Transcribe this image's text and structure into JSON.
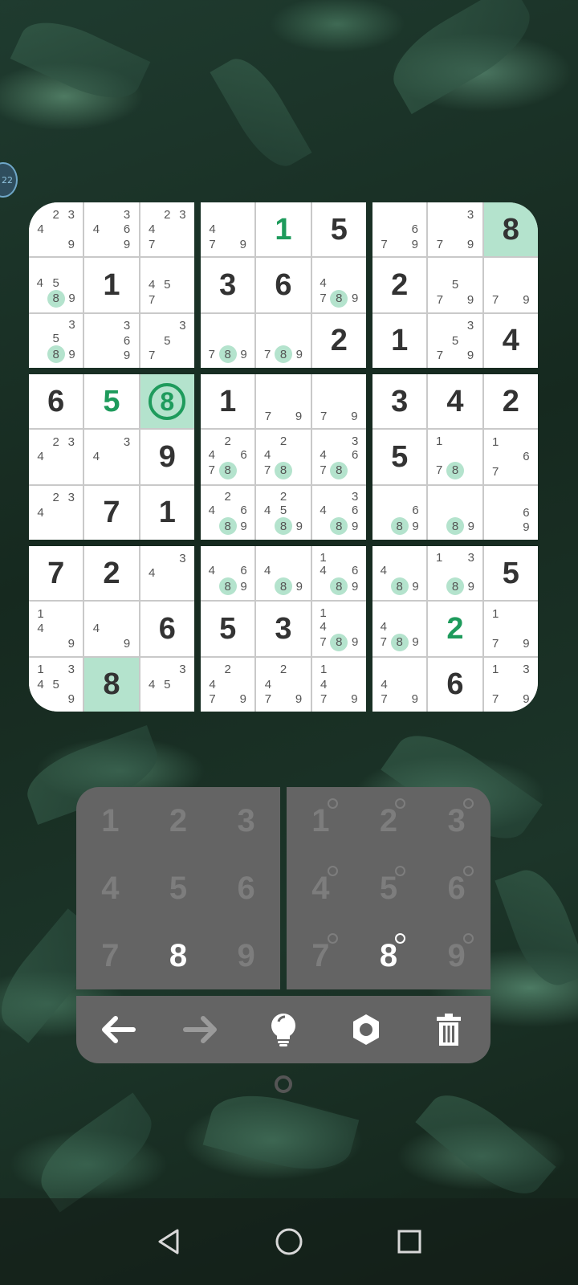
{
  "edge_badge": "22",
  "board": [
    [
      {
        "n": [
          "2",
          "3",
          "4",
          "",
          "",
          "9"
        ],
        "v": "",
        "hl": false,
        "h": []
      },
      {
        "v": "",
        "n": [
          "3",
          "4",
          "6",
          "9"
        ],
        "h": []
      },
      {
        "v": "",
        "n": [
          "2",
          "3",
          "4",
          "7"
        ],
        "h": []
      },
      {
        "v": "",
        "n": [
          "4",
          "5",
          "8",
          "9"
        ],
        "h": [
          "8"
        ]
      },
      {
        "v": "1"
      },
      {
        "v": "",
        "n": [
          "4",
          "5",
          "7"
        ],
        "h": []
      },
      {
        "v": "",
        "n": [
          "3",
          "5",
          "8",
          "9"
        ],
        "h": [
          "8"
        ]
      },
      {
        "v": "",
        "n": [
          "3",
          "6",
          "9"
        ],
        "h": []
      },
      {
        "v": "",
        "n": [
          "3",
          "5",
          "7"
        ],
        "h": []
      }
    ],
    [
      {
        "v": "",
        "n": [
          "4",
          "7",
          "9"
        ],
        "h": []
      },
      {
        "v": "1",
        "g": true
      },
      {
        "v": "5"
      },
      {
        "v": "3"
      },
      {
        "v": "6"
      },
      {
        "v": "",
        "n": [
          "4",
          "7",
          "8",
          "9"
        ],
        "h": [
          "8"
        ]
      },
      {
        "v": "",
        "n": [
          "7",
          "8",
          "9"
        ],
        "h": [
          "8"
        ]
      },
      {
        "v": "",
        "n": [
          "7",
          "8",
          "9"
        ],
        "h": [
          "8"
        ]
      },
      {
        "v": "2"
      }
    ],
    [
      {
        "v": "",
        "n": [
          "6",
          "7",
          "9"
        ],
        "h": []
      },
      {
        "v": "",
        "n": [
          "3",
          "7",
          "9"
        ],
        "h": []
      },
      {
        "v": "8",
        "hl": true
      },
      {
        "v": "2"
      },
      {
        "v": "",
        "n": [
          "5",
          "7",
          "9"
        ],
        "h": []
      },
      {
        "v": "",
        "n": [
          "7",
          "9"
        ],
        "h": []
      },
      {
        "v": "1"
      },
      {
        "v": "",
        "n": [
          "3",
          "5",
          "7",
          "9"
        ],
        "h": []
      },
      {
        "v": "4"
      }
    ],
    [
      {
        "v": "6"
      },
      {
        "v": "5",
        "g": true
      },
      {
        "v": "8",
        "ring": true,
        "hl": true
      },
      {
        "v": "",
        "n": [
          "2",
          "3",
          "4"
        ],
        "h": []
      },
      {
        "v": "",
        "n": [
          "3",
          "4"
        ],
        "h": []
      },
      {
        "v": "9"
      },
      {
        "v": "",
        "n": [
          "2",
          "3",
          "4"
        ],
        "h": []
      },
      {
        "v": "7"
      },
      {
        "v": "1"
      }
    ],
    [
      {
        "v": "1"
      },
      {
        "v": "",
        "n": [
          "7",
          "9"
        ],
        "h": []
      },
      {
        "v": "",
        "n": [
          "7",
          "9"
        ],
        "h": []
      },
      {
        "v": "",
        "n": [
          "2",
          "4",
          "6",
          "7",
          "8"
        ],
        "h": [
          "8"
        ]
      },
      {
        "v": "",
        "n": [
          "2",
          "4",
          "7",
          "8"
        ],
        "h": [
          "8"
        ]
      },
      {
        "v": "",
        "n": [
          "3",
          "4",
          "6",
          "7",
          "8"
        ],
        "h": [
          "8"
        ]
      },
      {
        "v": "",
        "n": [
          "2",
          "4",
          "6",
          "8",
          "9"
        ],
        "h": [
          "8"
        ]
      },
      {
        "v": "",
        "n": [
          "2",
          "4",
          "5",
          "8",
          "9"
        ],
        "h": [
          "8"
        ]
      },
      {
        "v": "",
        "n": [
          "3",
          "4",
          "6",
          "8",
          "9"
        ],
        "h": [
          "8"
        ]
      }
    ],
    [
      {
        "v": "3"
      },
      {
        "v": "4"
      },
      {
        "v": "2"
      },
      {
        "v": "5"
      },
      {
        "v": "",
        "n": [
          "1",
          "7",
          "8"
        ],
        "h": [
          "8"
        ]
      },
      {
        "v": "",
        "n": [
          "1",
          "6",
          "7"
        ],
        "h": []
      },
      {
        "v": "",
        "n": [
          "6",
          "8",
          "9"
        ],
        "h": [
          "8"
        ]
      },
      {
        "v": "",
        "n": [
          "8",
          "9"
        ],
        "h": [
          "8"
        ]
      },
      {
        "v": "",
        "n": [
          "6",
          "9"
        ],
        "h": []
      }
    ],
    [
      {
        "v": "7"
      },
      {
        "v": "2"
      },
      {
        "v": "",
        "n": [
          "3",
          "4"
        ],
        "h": []
      },
      {
        "v": "",
        "n": [
          "1",
          "4",
          "9"
        ],
        "h": []
      },
      {
        "v": "",
        "n": [
          "4",
          "9"
        ],
        "h": []
      },
      {
        "v": "6"
      },
      {
        "v": "",
        "n": [
          "1",
          "3",
          "4",
          "5",
          "9"
        ],
        "h": []
      },
      {
        "v": "8",
        "hl": true
      },
      {
        "v": "",
        "n": [
          "3",
          "4",
          "5"
        ],
        "h": []
      }
    ],
    [
      {
        "v": "",
        "n": [
          "4",
          "6",
          "8",
          "9"
        ],
        "h": [
          "8"
        ]
      },
      {
        "v": "",
        "n": [
          "4",
          "8",
          "9"
        ],
        "h": [
          "8"
        ]
      },
      {
        "v": "",
        "n": [
          "1",
          "4",
          "6",
          "8",
          "9"
        ],
        "h": [
          "8"
        ]
      },
      {
        "v": "5"
      },
      {
        "v": "3"
      },
      {
        "v": "",
        "n": [
          "1",
          "4",
          "7",
          "8",
          "9"
        ],
        "h": [
          "8"
        ]
      },
      {
        "v": "",
        "n": [
          "2",
          "4",
          "7",
          "9"
        ],
        "h": []
      },
      {
        "v": "",
        "n": [
          "2",
          "4",
          "7",
          "9"
        ],
        "h": []
      },
      {
        "v": "",
        "n": [
          "1",
          "4",
          "7",
          "9"
        ],
        "h": []
      }
    ],
    [
      {
        "v": "",
        "n": [
          "4",
          "8",
          "9"
        ],
        "h": [
          "8"
        ]
      },
      {
        "v": "",
        "n": [
          "1",
          "3",
          "8",
          "9"
        ],
        "h": [
          "8"
        ]
      },
      {
        "v": "5"
      },
      {
        "v": "",
        "n": [
          "4",
          "7",
          "8",
          "9"
        ],
        "h": [
          "8"
        ]
      },
      {
        "v": "2",
        "g": true
      },
      {
        "v": "",
        "n": [
          "1",
          "7",
          "9"
        ],
        "h": []
      },
      {
        "v": "",
        "n": [
          "4",
          "7",
          "9"
        ],
        "h": []
      },
      {
        "v": "6"
      },
      {
        "v": "",
        "n": [
          "1",
          "3",
          "7",
          "9"
        ],
        "h": []
      }
    ]
  ],
  "digit_pad": {
    "keys": [
      "1",
      "2",
      "3",
      "4",
      "5",
      "6",
      "7",
      "8",
      "9"
    ],
    "active": [
      "8"
    ]
  },
  "note_pad": {
    "keys": [
      "1",
      "2",
      "3",
      "4",
      "5",
      "6",
      "7",
      "8",
      "9"
    ],
    "active": [
      "8"
    ]
  },
  "toolbar": {
    "items": [
      "undo-arrow",
      "redo-arrow",
      "hint-bulb",
      "settings-gear",
      "delete-trash"
    ],
    "disabled": [
      "redo-arrow"
    ]
  },
  "colors": {
    "accent": "#1e9b5c",
    "highlight": "#b4e3cd",
    "pad_bg": "#646464"
  }
}
